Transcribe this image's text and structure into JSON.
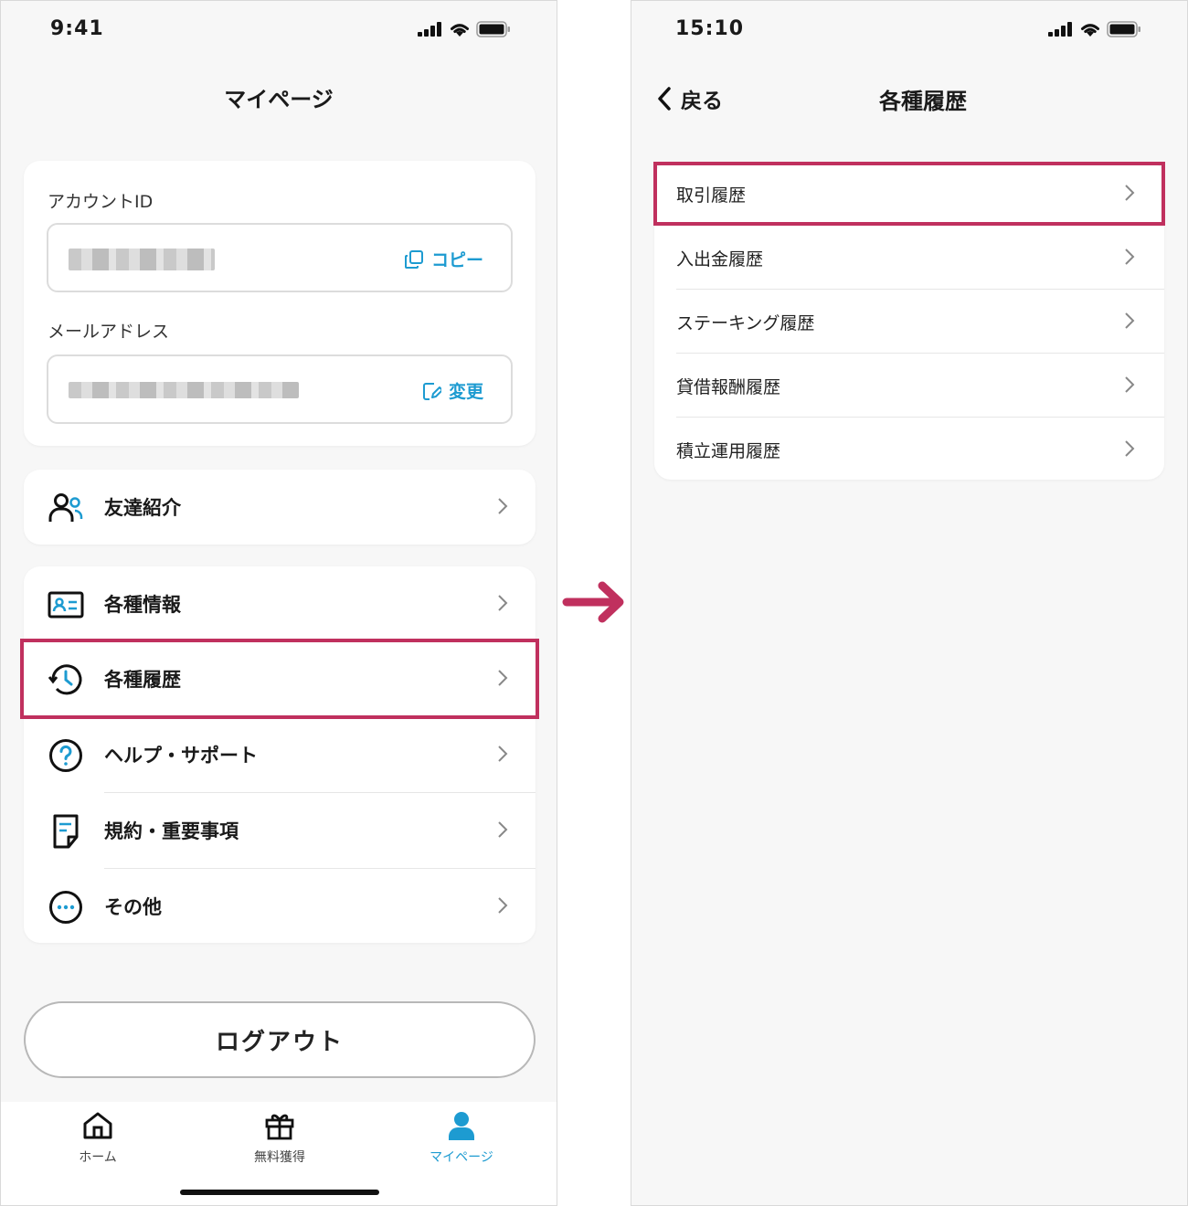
{
  "left_screen": {
    "status_time": "9:41",
    "title": "マイページ",
    "account": {
      "id_label": "アカウントID",
      "copy_label": "コピー",
      "email_label": "メールアドレス",
      "change_label": "変更"
    },
    "referral": {
      "label": "友達紹介",
      "icon": "people-icon"
    },
    "menu": [
      {
        "label": "各種情報",
        "icon": "id-card-icon"
      },
      {
        "label": "各種履歴",
        "icon": "history-icon",
        "highlighted": true
      },
      {
        "label": "ヘルプ・サポート",
        "icon": "question-icon"
      },
      {
        "label": "規約・重要事項",
        "icon": "document-icon"
      },
      {
        "label": "その他",
        "icon": "more-icon"
      }
    ],
    "logout_label": "ログアウト",
    "tabs": [
      {
        "label": "ホーム",
        "icon": "home-icon"
      },
      {
        "label": "無料獲得",
        "icon": "gift-icon"
      },
      {
        "label": "マイページ",
        "icon": "person-icon",
        "active": true
      }
    ]
  },
  "right_screen": {
    "status_time": "15:10",
    "back_label": "戻る",
    "title": "各種履歴",
    "items": [
      {
        "label": "取引履歴",
        "highlighted": true
      },
      {
        "label": "入出金履歴"
      },
      {
        "label": "ステーキング履歴"
      },
      {
        "label": "貸借報酬履歴"
      },
      {
        "label": "積立運用履歴"
      }
    ]
  },
  "colors": {
    "accent": "#1d9bd1",
    "highlight": "#c0305e",
    "background": "#f7f7f7"
  }
}
